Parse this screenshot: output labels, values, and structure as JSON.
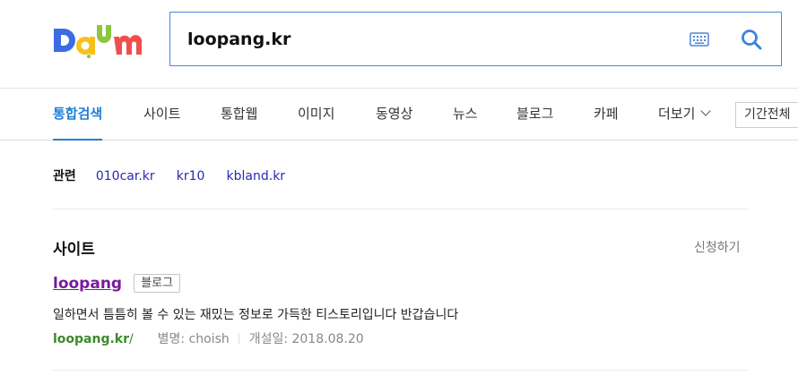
{
  "header": {
    "logo_text": "Daum",
    "search_value": "loopang.kr",
    "colors": {
      "search_border": "#4a87d6",
      "search_icon": "#3b82e0"
    }
  },
  "tabs": [
    {
      "label": "통합검색",
      "active": true
    },
    {
      "label": "사이트",
      "active": false
    },
    {
      "label": "통합웹",
      "active": false
    },
    {
      "label": "이미지",
      "active": false
    },
    {
      "label": "동영상",
      "active": false
    },
    {
      "label": "뉴스",
      "active": false
    },
    {
      "label": "블로그",
      "active": false
    },
    {
      "label": "카페",
      "active": false
    },
    {
      "label": "더보기",
      "active": false
    }
  ],
  "period_filter": "기간전체",
  "related": {
    "label": "관련",
    "items": [
      "010car.kr",
      "kr10",
      "kbland.kr"
    ]
  },
  "site_section": {
    "title": "사이트",
    "apply_label": "신청하기",
    "result": {
      "title": "loopang",
      "badge": "블로그",
      "description": "일하면서 틈틈히 볼 수 있는 재밌는 정보로 가득한 티스토리입니다 반갑습니다",
      "url": "loopang.kr",
      "url_suffix": "/",
      "alias": "별명: choish",
      "opened": "개설일: 2018.08.20"
    }
  }
}
